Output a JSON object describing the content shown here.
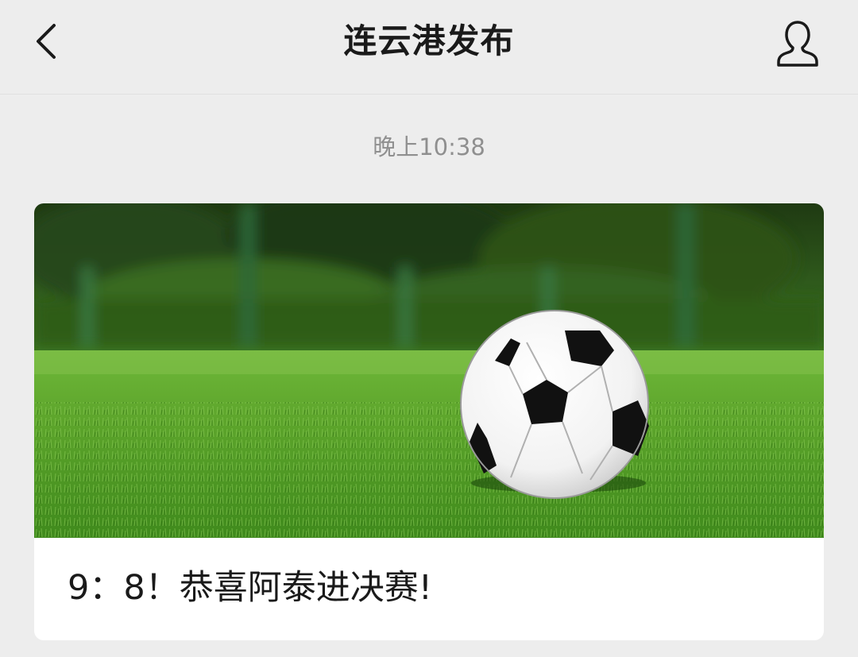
{
  "header": {
    "title": "连云港发布",
    "back_icon": "chevron-left-icon",
    "profile_icon": "user-profile-icon"
  },
  "message": {
    "timestamp": "晚上10:38"
  },
  "article": {
    "title": "9：8！恭喜阿泰进决赛!",
    "cover_image": "soccer-ball-on-grass"
  },
  "colors": {
    "background": "#ededed",
    "card": "#ffffff",
    "title_text": "#1a1a1a",
    "timestamp_text": "#8f8f8f"
  }
}
